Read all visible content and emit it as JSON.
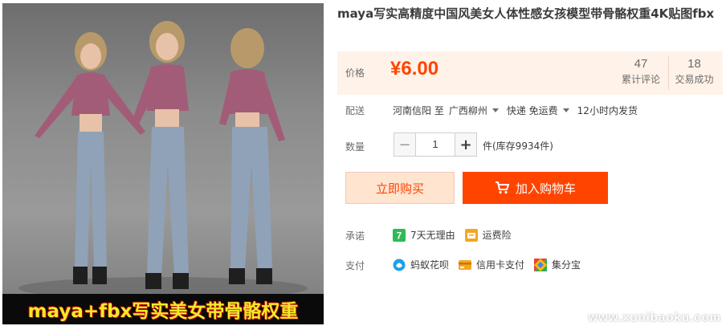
{
  "product": {
    "title": "maya写实高精度中国风美女人体性感女孩模型带骨骼权重4K贴图fbx",
    "image_banner": "maya+fbx写实美女带骨骼权重"
  },
  "price": {
    "label": "价格",
    "value": "¥6.00",
    "reviews_count": "47",
    "reviews_label": "累计评论",
    "sales_count": "18",
    "sales_label": "交易成功"
  },
  "shipping": {
    "label": "配送",
    "from": "河南信阳 至",
    "to": "广西柳州",
    "method": "快递 免运费",
    "dispatch": "12小时内发货"
  },
  "quantity": {
    "label": "数量",
    "minus": "−",
    "value": "1",
    "plus": "+",
    "stock": "件(库存9934件)"
  },
  "actions": {
    "buy_now": "立即购买",
    "add_to_cart": "加入购物车"
  },
  "promise": {
    "label": "承诺",
    "items": [
      {
        "text": "7天无理由",
        "icon": "seven-day-return-icon",
        "color": "#2dbb55"
      },
      {
        "text": "运费险",
        "icon": "shipping-insurance-icon",
        "color": "#f5a623"
      }
    ]
  },
  "payment": {
    "label": "支付",
    "items": [
      {
        "text": "蚂蚁花呗",
        "icon": "huabei-icon",
        "color": "#1e9fe8"
      },
      {
        "text": "信用卡支付",
        "icon": "credit-card-icon",
        "color": "#f5a623"
      },
      {
        "text": "集分宝",
        "icon": "jifenbao-icon",
        "color": "#34a853"
      }
    ]
  },
  "watermark": "www.xunibaoku.com",
  "colors": {
    "accent": "#ff4400",
    "price_bg": "#fff2e8",
    "buy_bg": "#ffe4d0"
  }
}
